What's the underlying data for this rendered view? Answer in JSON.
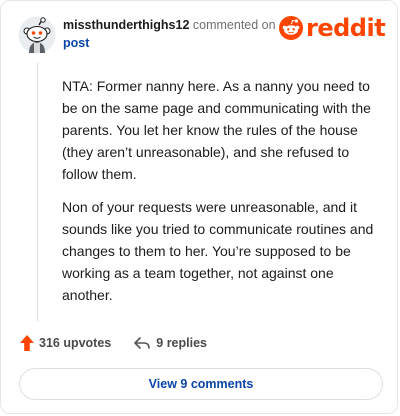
{
  "comment": {
    "username": "missthunderthighs12",
    "action": "commented on",
    "target": "post",
    "avatar_icon": "snoo-avatar-icon",
    "paragraphs": [
      "NTA: Former nanny here. As a nanny you need to be on the same page and communicating with the parents. You let her know the rules of the house (they aren’t unreasonable), and she refused to follow them.",
      "Non of your requests were unreasonable, and it sounds like you tried to communicate routines and changes to them to her. You’re supposed to be working as a team together, not against one another."
    ]
  },
  "brand": {
    "logo_text": "reddit",
    "color": "#ff4500"
  },
  "footer": {
    "upvotes": "316 upvotes",
    "replies": "9 replies",
    "view_comments": "View 9 comments",
    "upvote_icon": "upvote-arrow-icon",
    "reply_icon": "reply-arrow-icon"
  },
  "colors": {
    "link": "#0a45a8",
    "accent": "#ff4500",
    "muted": "#707070"
  }
}
